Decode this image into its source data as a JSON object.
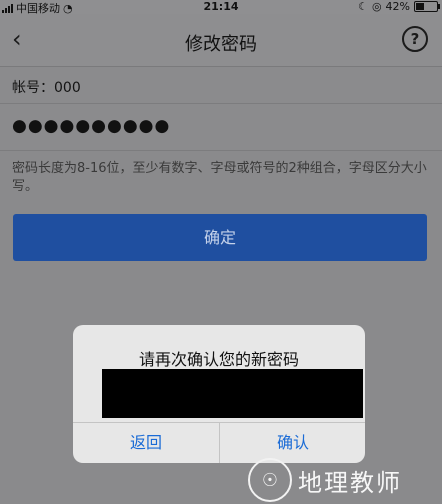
{
  "status_bar": {
    "carrier": "中国移动",
    "time": "21:14",
    "battery": "42%",
    "battery_level": 0.42
  },
  "nav": {
    "title": "修改密码",
    "back_icon": "chevron-left-icon",
    "help_label": "?"
  },
  "form": {
    "account_label": "帐号：000",
    "password_value": "●●●●●●●●●●",
    "hint": "密码长度为8-16位，至少有数字、字母或符号的2种组合，字母区分大小写。",
    "confirm_label": "确定"
  },
  "dialog": {
    "title": "请再次确认您的新密码",
    "cancel_label": "返回",
    "ok_label": "确认"
  },
  "watermark": {
    "text": "地理教师"
  },
  "colors": {
    "primary": "#1f4fa0",
    "dialog_button": "#1a6bd6",
    "overlay": "#8a8a8c"
  }
}
